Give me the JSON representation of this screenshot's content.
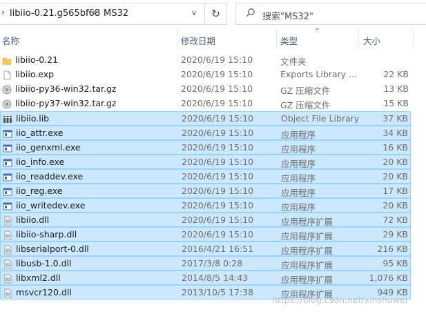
{
  "address_bar": {
    "segments": [
      "libiio-0.21.g565bf68",
      "MS32"
    ]
  },
  "search": {
    "placeholder": "搜索\"MS32\""
  },
  "columns": {
    "name": "名称",
    "date": "修改日期",
    "type": "类型",
    "size": "大小"
  },
  "files": [
    {
      "name": "libiio-0.21",
      "date": "2020/6/19 15:10",
      "type": "文件夹",
      "size": "",
      "icon": "folder-icon",
      "selected": false
    },
    {
      "name": "libiio.exp",
      "date": "2020/6/19 15:10",
      "type": "Exports Library ...",
      "size": "22 KB",
      "icon": "file-icon",
      "selected": false
    },
    {
      "name": "libiio-py36-win32.tar.gz",
      "date": "2020/6/19 15:10",
      "type": "GZ 压缩文件",
      "size": "13 KB",
      "icon": "archive-icon",
      "selected": false
    },
    {
      "name": "libiio-py37-win32.tar.gz",
      "date": "2020/6/19 15:10",
      "type": "GZ 压缩文件",
      "size": "15 KB",
      "icon": "archive-icon",
      "selected": false
    },
    {
      "name": "libiio.lib",
      "date": "2020/6/19 15:10",
      "type": "Object File Library",
      "size": "37 KB",
      "icon": "library-icon",
      "selected": true
    },
    {
      "name": "iio_attr.exe",
      "date": "2020/6/19 15:10",
      "type": "应用程序",
      "size": "34 KB",
      "icon": "exe-icon",
      "selected": true
    },
    {
      "name": "iio_genxml.exe",
      "date": "2020/6/19 15:10",
      "type": "应用程序",
      "size": "16 KB",
      "icon": "exe-icon",
      "selected": true
    },
    {
      "name": "iio_info.exe",
      "date": "2020/6/19 15:10",
      "type": "应用程序",
      "size": "20 KB",
      "icon": "exe-icon",
      "selected": true
    },
    {
      "name": "iio_readdev.exe",
      "date": "2020/6/19 15:10",
      "type": "应用程序",
      "size": "20 KB",
      "icon": "exe-icon",
      "selected": true
    },
    {
      "name": "iio_reg.exe",
      "date": "2020/6/19 15:10",
      "type": "应用程序",
      "size": "17 KB",
      "icon": "exe-icon",
      "selected": true
    },
    {
      "name": "iio_writedev.exe",
      "date": "2020/6/19 15:10",
      "type": "应用程序",
      "size": "20 KB",
      "icon": "exe-icon",
      "selected": true
    },
    {
      "name": "libiio.dll",
      "date": "2020/6/19 15:10",
      "type": "应用程序扩展",
      "size": "72 KB",
      "icon": "dll-icon",
      "selected": true
    },
    {
      "name": "libiio-sharp.dll",
      "date": "2020/6/19 15:10",
      "type": "应用程序扩展",
      "size": "29 KB",
      "icon": "dll-icon",
      "selected": true
    },
    {
      "name": "libserialport-0.dll",
      "date": "2016/4/21 16:51",
      "type": "应用程序扩展",
      "size": "216 KB",
      "icon": "dll-icon",
      "selected": true
    },
    {
      "name": "libusb-1.0.dll",
      "date": "2017/3/8 0:28",
      "type": "应用程序扩展",
      "size": "95 KB",
      "icon": "dll-icon",
      "selected": true
    },
    {
      "name": "libxml2.dll",
      "date": "2014/8/5 14:43",
      "type": "应用程序扩展",
      "size": "1,076 KB",
      "icon": "dll-icon",
      "selected": true
    },
    {
      "name": "msvcr120.dll",
      "date": "2013/10/5 17:38",
      "type": "应用程序扩展",
      "size": "949 KB",
      "icon": "dll-icon",
      "selected": true
    }
  ],
  "watermark": "https://blog.csdn.net/xinshuwei",
  "colors": {
    "selection_fill": "#cce8ff",
    "selection_border": "#99d1ff",
    "header_text": "#4c607a",
    "folder": "#f5c95b"
  }
}
